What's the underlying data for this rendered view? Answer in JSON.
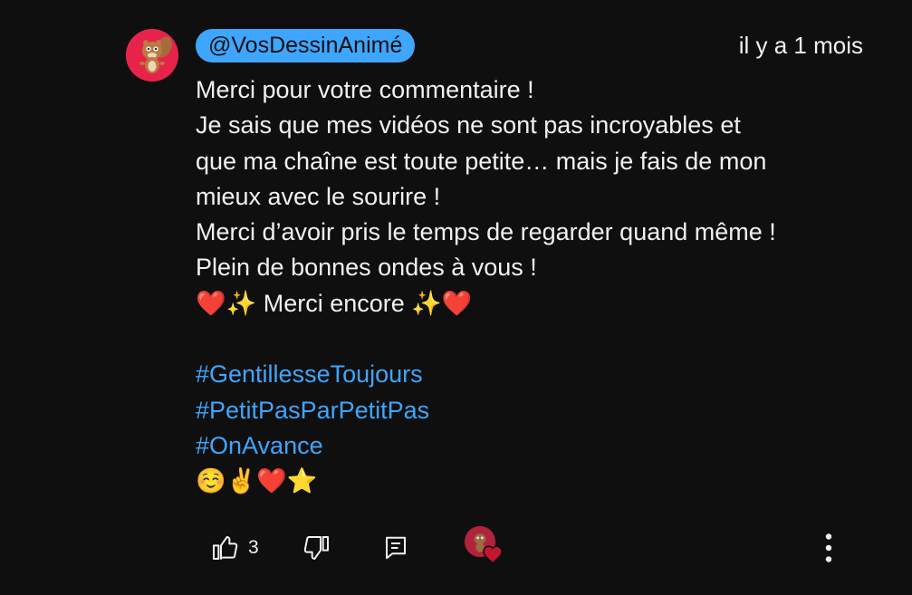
{
  "comment": {
    "author": "@VosDessinAnimé",
    "timestamp": "il y a 1 mois",
    "avatar_icon": "cartoon-squirrel-avatar",
    "text_lines": [
      "Merci pour votre commentaire !",
      "Je sais que mes vidéos ne sont pas incroyables et",
      "que ma chaîne est toute petite… mais je fais de mon",
      "mieux avec le sourire !",
      "Merci d’avoir pris le temps de regarder quand même !",
      "Plein de bonnes ondes à vous !",
      "❤️✨ Merci encore ✨❤️"
    ],
    "hashtags": [
      "#GentillesseToujours",
      "#PetitPasParPetitPas",
      "#OnAvance"
    ],
    "emoji_line": "☺️✌️❤️⭐"
  },
  "actions": {
    "like_icon": "thumb-up-icon",
    "like_count": "3",
    "dislike_icon": "thumb-down-icon",
    "reply_icon": "reply-icon",
    "creator_heart_icon": "creator-heart-icon",
    "more_icon": "more-vert-icon"
  },
  "colors": {
    "background": "#0f0f0f",
    "text": "#f1f1f1",
    "link": "#3ea6ff",
    "author_chip_bg": "#3ea6ff",
    "avatar_bg": "#e8234a",
    "heart": "#c4162e"
  }
}
